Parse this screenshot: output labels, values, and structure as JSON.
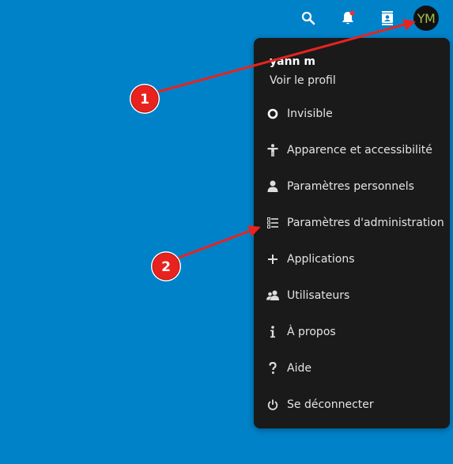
{
  "topbar": {
    "icons": [
      "search-icon",
      "notifications-icon",
      "contacts-icon"
    ],
    "avatar_initials": "YM",
    "notification_dot_color": "#e9322d"
  },
  "menu": {
    "user_name": "yann m",
    "profile_link": "Voir le profil",
    "items": [
      {
        "label": "Invisible",
        "icon": "status-circle-icon"
      },
      {
        "label": "Apparence et accessibilité",
        "icon": "accessibility-icon"
      },
      {
        "label": "Paramètres personnels",
        "icon": "person-icon"
      },
      {
        "label": "Paramètres d'administration",
        "icon": "admin-list-icon"
      },
      {
        "label": "Applications",
        "icon": "plus-icon"
      },
      {
        "label": "Utilisateurs",
        "icon": "users-icon"
      },
      {
        "label": "À propos",
        "icon": "info-icon"
      },
      {
        "label": "Aide",
        "icon": "help-icon"
      },
      {
        "label": "Se déconnecter",
        "icon": "power-icon"
      }
    ]
  },
  "annotations": {
    "badges": [
      "1",
      "2"
    ],
    "color": "#e8231f"
  },
  "colors": {
    "background": "#0082c9",
    "menu_background": "#1a1a1a",
    "avatar_text": "#9fbf4a"
  }
}
